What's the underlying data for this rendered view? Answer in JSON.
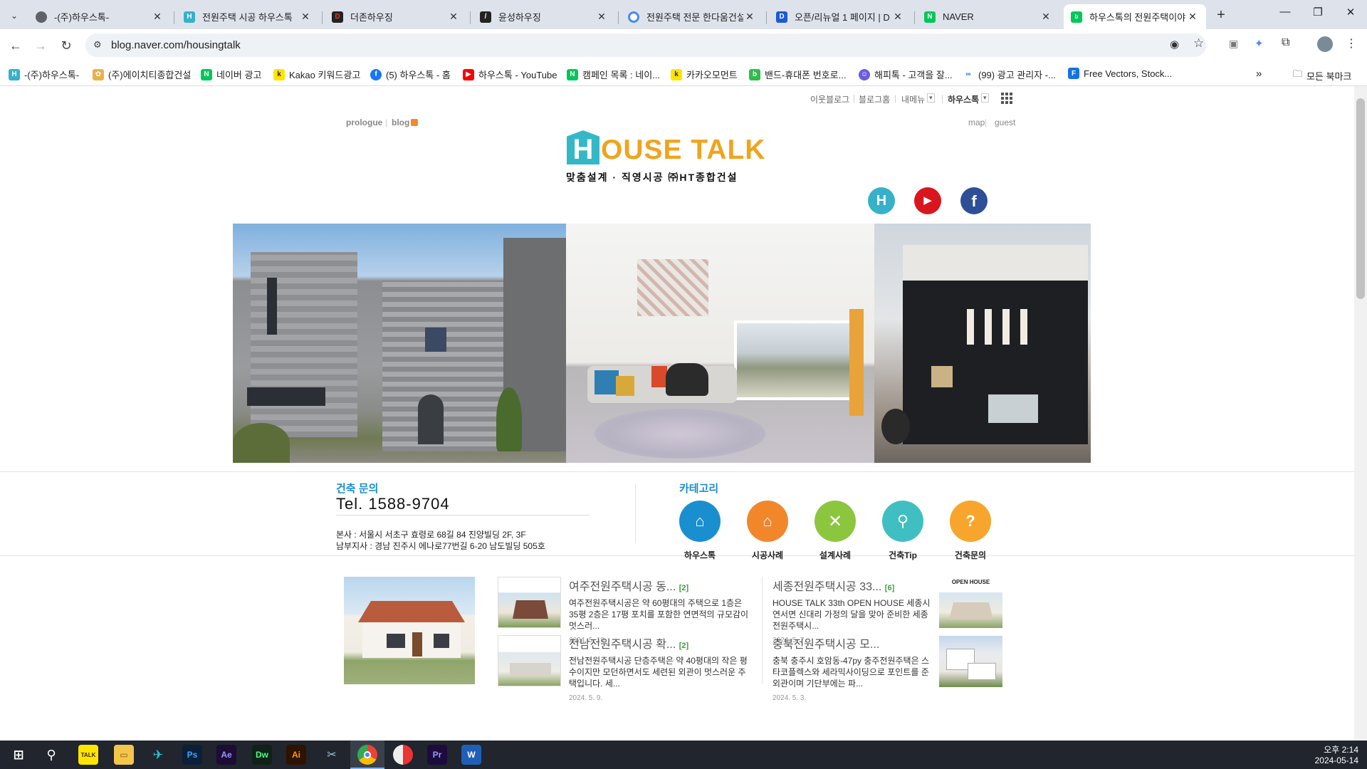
{
  "browser": {
    "tabs": [
      {
        "label": "-(주)하우스톡-"
      },
      {
        "label": "전원주택 시공 하우스톡"
      },
      {
        "label": "더존하우징"
      },
      {
        "label": "윤성하우징"
      },
      {
        "label": "전원주택 전문 한다움건설"
      },
      {
        "label": "오픈/리뉴얼 1 페이지 | D"
      },
      {
        "label": "NAVER"
      },
      {
        "label": "하우스톡의 전원주택이야"
      }
    ],
    "url": "blog.naver.com/housingtalk",
    "bookmarks": [
      "-(주)하우스톡-",
      "(주)에이치티종합건설",
      "네이버 광고",
      "Kakao 키워드광고",
      "(5) 하우스톡 - 홈",
      "하우스톡 - YouTube",
      "캠페인 목록 : 네이...",
      "카카오모먼트",
      "밴드-휴대폰 번호로...",
      "해피톡 - 고객을 잘...",
      "(99) 광고 관리자 -...",
      "Free Vectors, Stock..."
    ],
    "all_bookmarks": "모든 북마크"
  },
  "blog": {
    "gnb": [
      "이웃블로그",
      "블로그홈",
      "내메뉴",
      "하우스톡"
    ],
    "nav_left": [
      "prologue",
      "blog"
    ],
    "nav_right": [
      "map",
      "guest"
    ],
    "logo_h": "H",
    "logo_text": "OUSE TALK",
    "tagline": "맞춤설계 · 직영시공 ㈜HT종합건설",
    "contact_title": "건축 문의",
    "phone": "Tel. 1588-9704",
    "addr1": "본사 : 서울시 서초구 효령로 68길 84 진양빌딩 2F, 3F",
    "addr2": "남부지사 : 경남 진주시 에나로77번길 6-20 남도빌딩 505호",
    "category_title": "카테고리",
    "categories": [
      "하우스톡",
      "시공사례",
      "설계사례",
      "건축Tip",
      "건축문의"
    ],
    "posts": [
      {
        "title": "여주전원주택시공 동...",
        "count": "[2]",
        "excerpt": "여주전원주택시공은 약 60평대의 주택으로 1층은 35평 2층은 17평 포치를 포함한 연면적의 규모감이 멋스러...",
        "date": "2024. 5. 10."
      },
      {
        "title": "전남전원주택시공 확...",
        "count": "[2]",
        "excerpt": "전남전원주택시공 단층주택은 약 40평대의 작은 평수이지만 모던하면서도 세련된 외관이 멋스러운 주택입니다. 세...",
        "date": "2024. 5. 9."
      },
      {
        "title": "세종전원주택시공 33...",
        "count": "[6]",
        "excerpt": "HOUSE TALK 33th OPEN HOUSE 세종시 연서면 신대리 가정의 달을 맞아 준비한 세종전원주택시...",
        "date": "2024. 5. 7."
      },
      {
        "title": "충북전원주택시공 모...",
        "count": "",
        "excerpt": "충북 충주시 호암동-47py 충주전원주택은 스타코플렉스와 세라믹사이딩으로 포인트를 준 외관이며 기단부에는 파...",
        "date": "2024. 5. 3."
      }
    ],
    "thumb_badge": "OPEN HOUSE"
  },
  "taskbar": {
    "time": "오후 2:14",
    "date": "2024-05-14"
  }
}
